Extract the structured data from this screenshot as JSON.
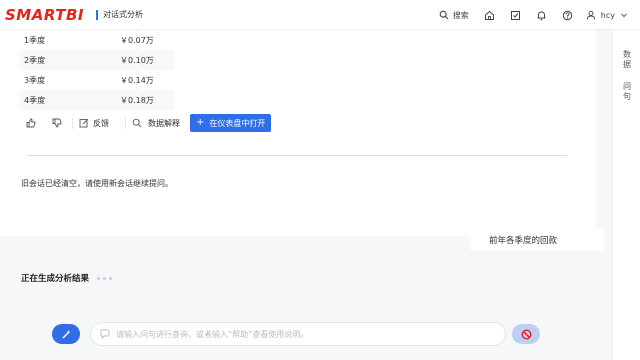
{
  "header": {
    "logo_text": "SMARTBI",
    "app_title": "对话式分析",
    "search_label": "搜索",
    "user_name": "hcy"
  },
  "right_rail": {
    "items": [
      {
        "label": "数\n据"
      },
      {
        "label": "问\n句"
      }
    ]
  },
  "table": {
    "rows": [
      {
        "quarter": "1季度",
        "value": "￥0.07万"
      },
      {
        "quarter": "2季度",
        "value": "￥0.10万"
      },
      {
        "quarter": "3季度",
        "value": "￥0.14万"
      },
      {
        "quarter": "4季度",
        "value": "￥0.18万"
      }
    ]
  },
  "actions": {
    "feedback_label": "反馈",
    "explain_label": "数据解释",
    "open_dashboard_label": "在仪表盘中打开"
  },
  "notice_text": "旧会话已经清空，请使用新会话继续提问。",
  "user_message": "前年各季度的回款",
  "status": {
    "generating_text": "正在生成分析结果"
  },
  "composer": {
    "placeholder": "请输入问句进行查询，或者输入“帮助”查看使用说明。"
  },
  "colors": {
    "brand": "#e1251b",
    "primary": "#2f6de9"
  }
}
